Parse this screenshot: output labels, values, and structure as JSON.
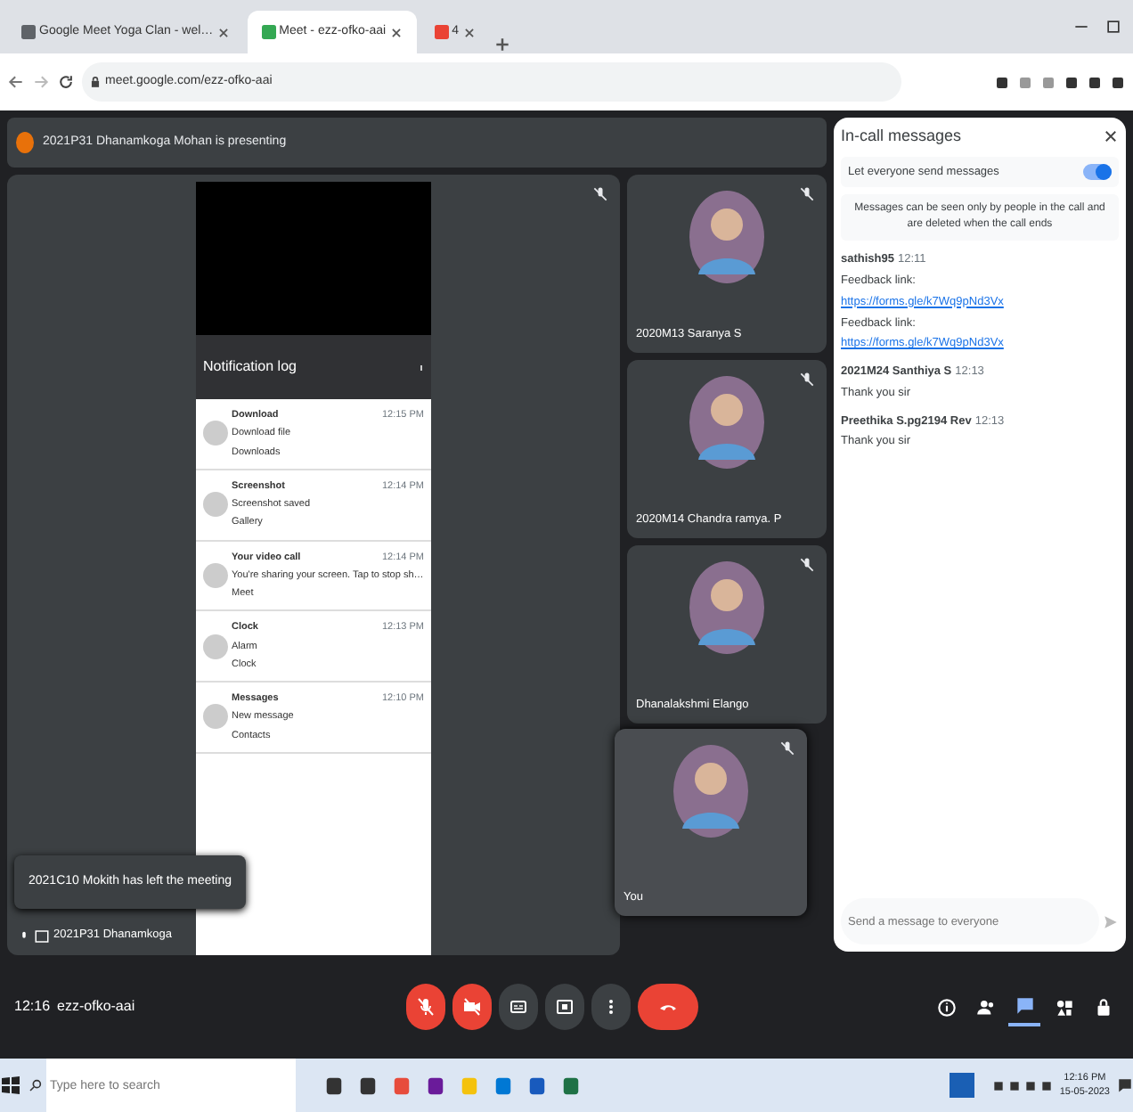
{
  "browser": {
    "tabs": [
      {
        "title": "Google Meet Yoga Clan - wel…",
        "selected": false
      },
      {
        "title": "Meet - ezz-ofko-aai",
        "selected": true
      },
      {
        "title": "4",
        "selected": false
      }
    ],
    "url": "meet.google.com/ezz-ofko-aai"
  },
  "meeting": {
    "presenting_banner": "2021P31 Dhanamkoga Mohan is presenting",
    "presentation": {
      "title": "Notification log",
      "notifications": [
        {
          "title": "Download",
          "time": "12:15 PM",
          "text": "Download file",
          "app": "Downloads"
        },
        {
          "title": "Screenshot",
          "time": "12:14 PM",
          "text": "Screenshot saved",
          "app": "Gallery"
        },
        {
          "title": "Your video call",
          "time": "12:14 PM",
          "text": "You're sharing your screen. Tap to stop sh…",
          "app": "Meet"
        },
        {
          "title": "Clock",
          "time": "12:13 PM",
          "text": "Alarm",
          "app": "Clock"
        },
        {
          "title": "Messages",
          "time": "12:10 PM",
          "text": "New message",
          "app": "Contacts"
        }
      ]
    },
    "presenter_label": "2021P31 Dhanamkoga",
    "toast": "2021C10 Mokith has left the meeting",
    "participants": [
      {
        "name": "2020M13 Saranya S"
      },
      {
        "name": "2020M14 Chandra ramya. P"
      },
      {
        "name": "Dhanalakshmi Elango"
      }
    ],
    "self_tile": {
      "name": "You"
    }
  },
  "chat": {
    "title": "In-call messages",
    "setting": "Let everyone send messages",
    "setting_on": true,
    "notice": "Messages can be seen only by people in the call and are deleted when the call ends",
    "messages": [
      {
        "sender": "sathish95",
        "time": "12:11",
        "lines": [
          {
            "kind": "text",
            "text": "Feedback link:"
          },
          {
            "kind": "link",
            "text": "https://forms.gle/k7Wq9pNd3Vx"
          },
          {
            "kind": "text",
            "text": "Feedback link:"
          },
          {
            "kind": "link",
            "text": "https://forms.gle/k7Wq9pNd3Vx"
          }
        ]
      },
      {
        "sender": "2021M24 Santhiya S",
        "time": "12:13",
        "lines": [
          {
            "kind": "text",
            "text": "Thank you sir"
          }
        ]
      },
      {
        "sender": "Preethika S.pg2194 Rev",
        "time": "12:13",
        "lines": [
          {
            "kind": "text",
            "text": "Thank you sir"
          }
        ]
      }
    ],
    "placeholder": "Send a message to everyone"
  },
  "controls": {
    "time": "12:16",
    "meeting_code": "ezz-ofko-aai",
    "buttons": [
      {
        "kind": "mic",
        "on": false
      },
      {
        "kind": "camera",
        "on": false
      },
      {
        "kind": "captions"
      },
      {
        "kind": "present"
      },
      {
        "kind": "more"
      },
      {
        "kind": "end"
      }
    ],
    "side_buttons": [
      {
        "kind": "info",
        "selected": false
      },
      {
        "kind": "people",
        "selected": false
      },
      {
        "kind": "chat",
        "selected": true
      },
      {
        "kind": "activities",
        "selected": false
      },
      {
        "kind": "lock",
        "selected": false
      }
    ]
  },
  "taskbar": {
    "search_placeholder": "Type here to search",
    "time": "12:16 PM",
    "date": "15-05-2023"
  }
}
